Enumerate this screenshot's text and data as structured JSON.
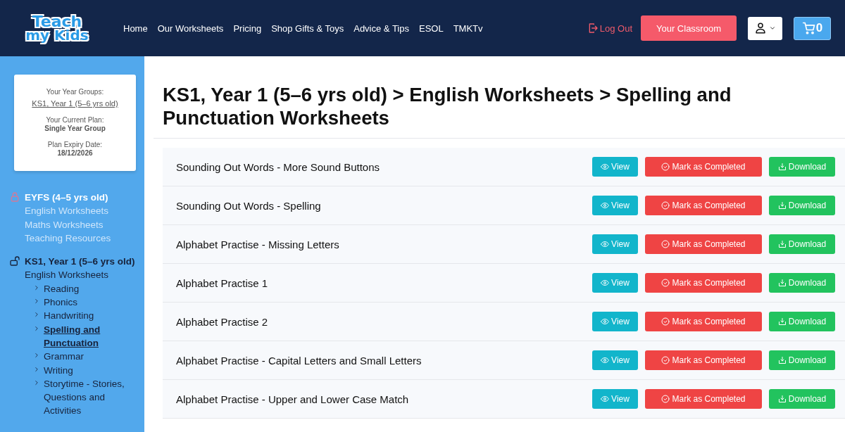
{
  "logo": {
    "line_1": "Teach",
    "line_2": "my Kids"
  },
  "nav": [
    {
      "label": "Home"
    },
    {
      "label": "Our Worksheets"
    },
    {
      "label": "Pricing"
    },
    {
      "label": "Shop Gifts & Toys"
    },
    {
      "label": "Advice & Tips"
    },
    {
      "label": "ESOL"
    },
    {
      "label": "TMKTv"
    }
  ],
  "header_actions": {
    "logout": "Log Out",
    "classroom": "Your Classroom",
    "cart_count": "0"
  },
  "account_card": {
    "year_groups_label": "Your Year Groups:",
    "year_groups_link": "KS1, Year 1 (5–6 yrs old)",
    "plan_label": "Your Current Plan:",
    "plan": "Single Year Group",
    "expiry_label": "Plan Expiry Date:",
    "expiry": "18/12/2026"
  },
  "sidebar": {
    "groups": [
      {
        "title": "EYFS (4–5 yrs old)",
        "locked": true,
        "children": [
          {
            "label": "English Worksheets",
            "selected": false
          },
          {
            "label": "Maths Worksheets",
            "selected": false
          },
          {
            "label": "Teaching Resources",
            "selected": false
          }
        ]
      },
      {
        "title": "KS1, Year 1 (5–6 yrs old)",
        "locked": false,
        "children": [
          {
            "label": "English Worksheets",
            "selected": false,
            "children": [
              {
                "label": "Reading",
                "selected": false
              },
              {
                "label": "Phonics",
                "selected": false
              },
              {
                "label": "Handwriting",
                "selected": false
              },
              {
                "label": "Spelling and Punctuation",
                "selected": true
              },
              {
                "label": "Grammar",
                "selected": false
              },
              {
                "label": "Writing",
                "selected": false
              },
              {
                "label": "Storytime - Stories, Questions and Activities",
                "selected": false
              }
            ]
          }
        ]
      }
    ]
  },
  "page_title": "KS1, Year 1 (5–6 yrs old) > English Worksheets > Spelling and Punctuation Worksheets",
  "worksheets": [
    {
      "title": "Sounding Out Words - More Sound Buttons",
      "view": "View",
      "complete": "Mark as Completed",
      "download": "Download"
    },
    {
      "title": "Sounding Out Words - Spelling",
      "view": "View",
      "complete": "Mark as Completed",
      "download": "Download"
    },
    {
      "title": "Alphabet Practise - Missing Letters",
      "view": "View",
      "complete": "Mark as Completed",
      "download": "Download"
    },
    {
      "title": "Alphabet Practise 1",
      "view": "View",
      "complete": "Mark as Completed",
      "download": "Download"
    },
    {
      "title": "Alphabet Practise 2",
      "view": "View",
      "complete": "Mark as Completed",
      "download": "Download"
    },
    {
      "title": "Alphabet Practise - Capital Letters and Small Letters",
      "view": "View",
      "complete": "Mark as Completed",
      "download": "Download"
    },
    {
      "title": "Alphabet Practise - Upper and Lower Case Match",
      "view": "View",
      "complete": "Mark as Completed",
      "download": "Download"
    }
  ]
}
